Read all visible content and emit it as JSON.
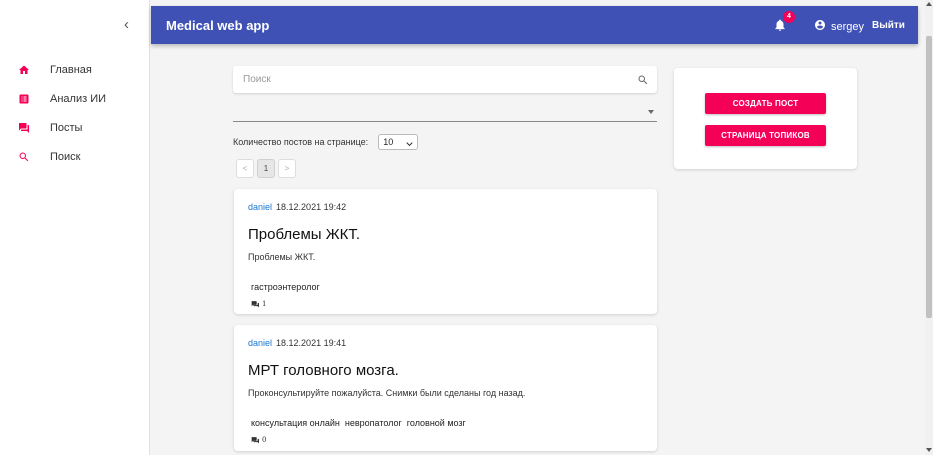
{
  "sidebar": {
    "collapse_icon": "chevron-left-icon",
    "collapse_glyph": "‹",
    "items": [
      {
        "label": "Главная",
        "icon": "home-icon"
      },
      {
        "label": "Анализ ИИ",
        "icon": "assessment-icon"
      },
      {
        "label": "Посты",
        "icon": "forum-icon"
      },
      {
        "label": "Поиск",
        "icon": "search-icon"
      }
    ]
  },
  "header": {
    "title": "Medical web app",
    "notifications_count": "4",
    "username": "sergey",
    "logout_label": "Выйти"
  },
  "search": {
    "placeholder": "Поиск",
    "value": ""
  },
  "topic_filter": {
    "selected": ""
  },
  "pagination": {
    "per_page_label": "Количество постов на странице:",
    "per_page_value": "10",
    "prev_label": "<",
    "current_page": "1",
    "next_label": ">"
  },
  "posts": [
    {
      "author": "daniel",
      "datetime": "18.12.2021 19:42",
      "title": "Проблемы ЖКТ.",
      "text": "Проблемы ЖКТ.",
      "tags": [
        "гастроэнтеролог"
      ],
      "comments": "1"
    },
    {
      "author": "daniel",
      "datetime": "18.12.2021 19:41",
      "title": "МРТ головного мозга.",
      "text": "Проконсультируйте пожалуйста. Снимки были сделаны год назад.",
      "tags": [
        "консультация онлайн",
        "невропатолог",
        "головной мозг"
      ],
      "comments": "0"
    }
  ],
  "actions": {
    "create_post_label": "СОЗДАТЬ ПОСТ",
    "topics_page_label": "СТРАНИЦА ТОПИКОВ"
  },
  "colors": {
    "header_bg": "#3f51b5",
    "accent": "#f50057",
    "link": "#1976d2"
  }
}
